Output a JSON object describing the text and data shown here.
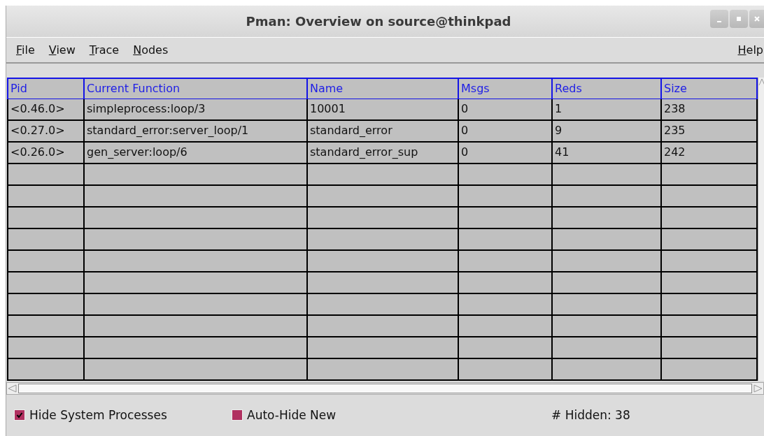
{
  "window": {
    "title": "Pman: Overview on source@thinkpad"
  },
  "menu": {
    "left": [
      "File",
      "View",
      "Trace",
      "Nodes"
    ],
    "right": [
      "Help"
    ]
  },
  "table": {
    "columns": [
      "Pid",
      "Current Function",
      "Name",
      "Msgs",
      "Reds",
      "Size"
    ],
    "rows": [
      [
        "<0.46.0>",
        "simpleprocess:loop/3",
        "10001",
        "0",
        "1",
        "238"
      ],
      [
        "<0.27.0>",
        "standard_error:server_loop/1",
        "standard_error",
        "0",
        "9",
        "235"
      ],
      [
        "<0.26.0>",
        "gen_server:loop/6",
        "standard_error_sup",
        "0",
        "41",
        "242"
      ]
    ]
  },
  "options": [
    {
      "label": "Hide System Processes",
      "checked": true
    },
    {
      "label": "Auto-Hide New",
      "checked": false
    }
  ],
  "hidden_count": "# Hidden: 38"
}
